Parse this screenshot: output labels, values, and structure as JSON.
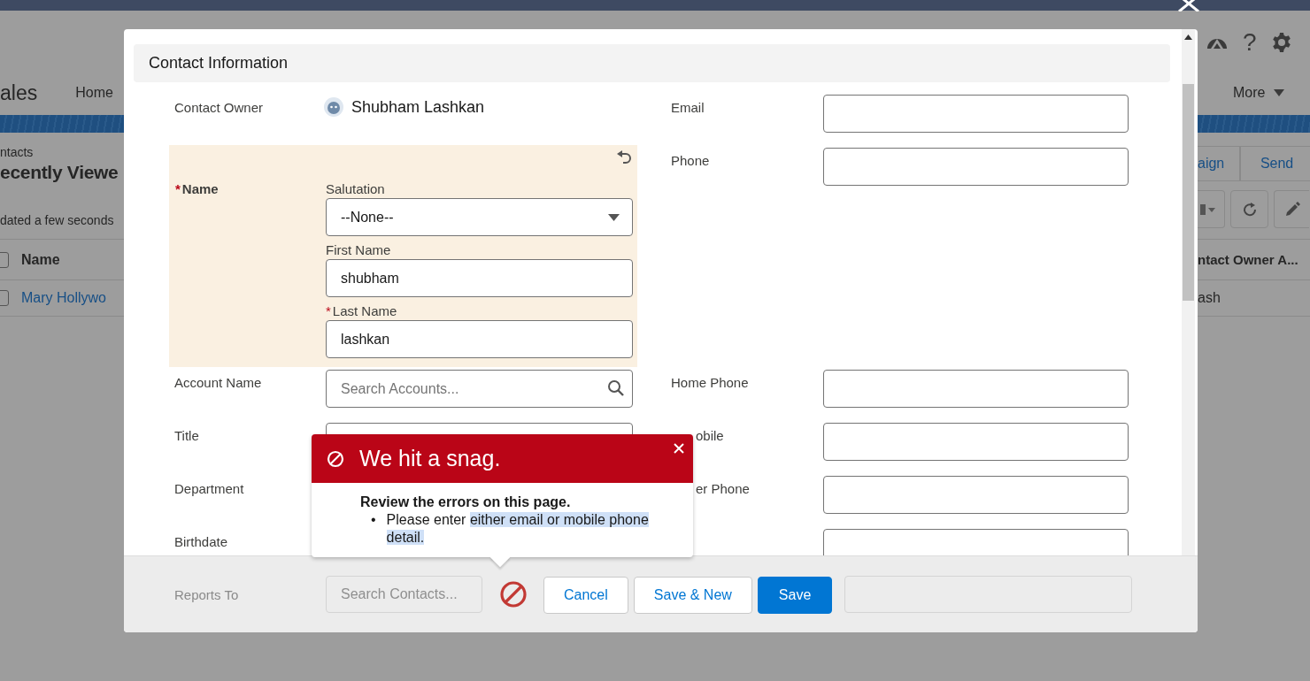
{
  "background": {
    "app_name": "ales",
    "nav_items": [
      "Home"
    ],
    "more": "More",
    "help_glyph": "?",
    "breadcrumb": "ntacts",
    "list_title": "ecently Viewe",
    "updated": "dated a few seconds",
    "header_buttons": [
      "aign",
      "Send"
    ],
    "table": {
      "columns": [
        "Name",
        "ntact Owner A..."
      ],
      "select_all_checked": false,
      "rows": [
        {
          "checked": false,
          "cells": [
            "Mary Hollywo",
            "ash"
          ]
        }
      ]
    }
  },
  "modal": {
    "section": "Contact Information",
    "owner": {
      "label": "Contact Owner",
      "value": "Shubham Lashkan"
    },
    "name": {
      "label": "Name",
      "required_mark": "*",
      "salutation": {
        "label": "Salutation",
        "value": "--None--"
      },
      "first_name": {
        "label": "First Name",
        "value": "shubham"
      },
      "last_name": {
        "label": "Last Name",
        "required_mark": "*",
        "value": "lashkan"
      }
    },
    "left_fields": [
      {
        "label": "Account Name",
        "kind": "lookup",
        "placeholder": "Search Accounts..."
      },
      {
        "label": "Title",
        "kind": "text"
      },
      {
        "label": "Department"
      },
      {
        "label": "Birthdate"
      }
    ],
    "right_top": [
      {
        "label": "Email",
        "kind": "text"
      },
      {
        "label": "Phone",
        "kind": "text"
      }
    ],
    "right_bottom": [
      {
        "label": "Home Phone",
        "kind": "text"
      },
      {
        "label": "obile",
        "kind": "text",
        "covered": true
      },
      {
        "label": "er Phone",
        "kind": "text",
        "covered": true
      },
      {
        "kind": "text"
      }
    ],
    "footer_fields": [
      {
        "label": "Reports To",
        "placeholder": "Search Contacts..."
      },
      {
        "kind": "text"
      }
    ],
    "buttons": [
      {
        "label": "Cancel",
        "kind": "neutral"
      },
      {
        "label": "Save & New",
        "kind": "neutral"
      },
      {
        "label": "Save",
        "kind": "brand"
      }
    ]
  },
  "error_popover": {
    "title": "We hit a snag.",
    "heading": "Review the errors on this page.",
    "errors": [
      {
        "bullet": "•",
        "text": "Please enter",
        "highlighted": "either email or mobile phone detail."
      }
    ]
  }
}
